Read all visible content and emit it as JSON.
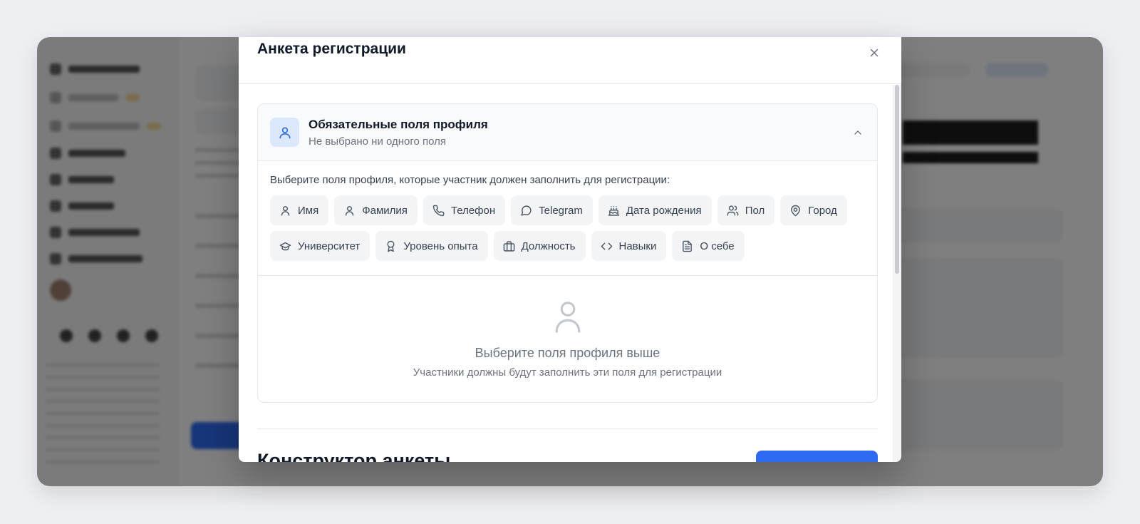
{
  "modal": {
    "title": "Анкета регистрации",
    "close_icon": "close-icon"
  },
  "profile_section": {
    "title": "Обязательные поля профиля",
    "subtitle": "Не выбрано ни одного поля",
    "icon": "user-icon",
    "collapse_icon": "chevron-up-icon",
    "instruction": "Выберите поля профиля, которые участник должен заполнить для регистрации:",
    "fields": [
      {
        "label": "Имя",
        "icon": "user-icon"
      },
      {
        "label": "Фамилия",
        "icon": "user-icon"
      },
      {
        "label": "Телефон",
        "icon": "phone-icon"
      },
      {
        "label": "Telegram",
        "icon": "message-circle-icon"
      },
      {
        "label": "Дата рождения",
        "icon": "cake-icon"
      },
      {
        "label": "Пол",
        "icon": "users-icon"
      },
      {
        "label": "Город",
        "icon": "map-pin-icon"
      },
      {
        "label": "Университет",
        "icon": "graduation-cap-icon"
      },
      {
        "label": "Уровень опыта",
        "icon": "award-icon"
      },
      {
        "label": "Должность",
        "icon": "briefcase-icon"
      },
      {
        "label": "Навыки",
        "icon": "code-icon"
      },
      {
        "label": "О себе",
        "icon": "file-text-icon"
      }
    ],
    "empty_state": {
      "icon": "user-icon",
      "title": "Выберите поля профиля выше",
      "subtitle": "Участники должны будут заполнить эти поля для регистрации"
    }
  },
  "builder": {
    "title": "Конструктор анкеты"
  },
  "colors": {
    "accent": "#2f6bf2",
    "icon_box": "#dbe7fb",
    "chip_bg": "#f3f4f6"
  }
}
